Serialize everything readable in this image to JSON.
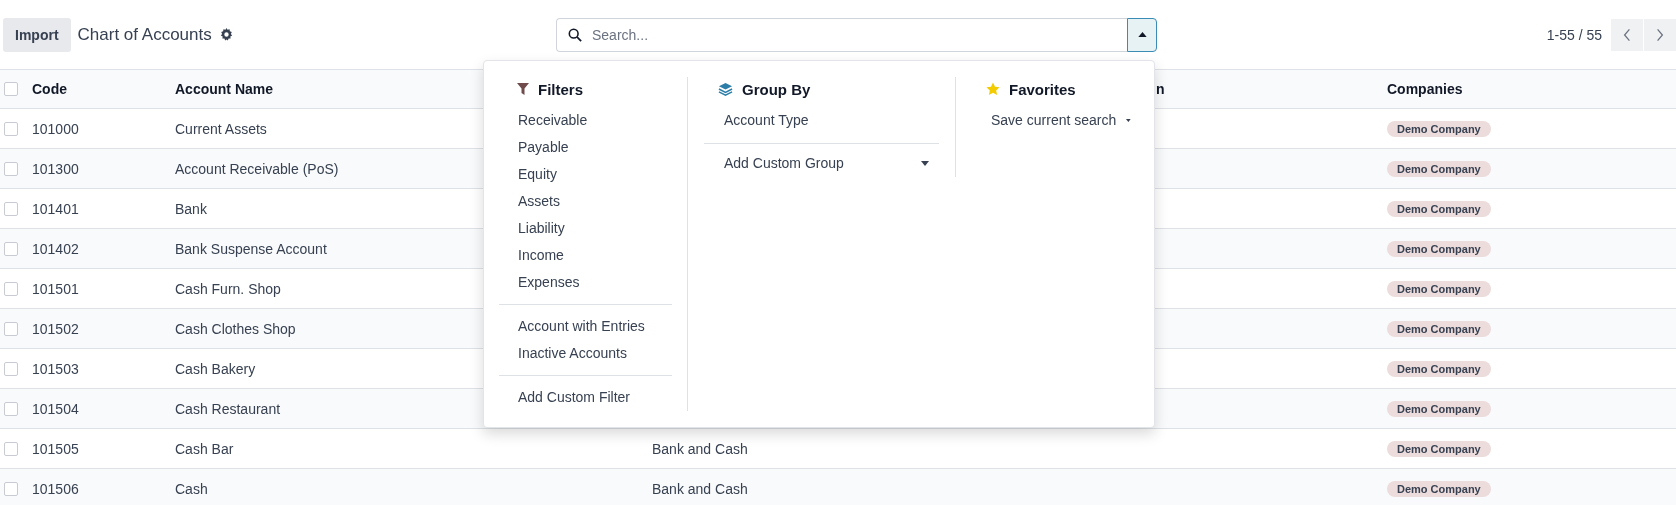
{
  "control_panel": {
    "import_button": "Import",
    "title": "Chart of Accounts",
    "search": {
      "placeholder": "Search...",
      "panel_open": true
    },
    "pager": "1-55 / 55"
  },
  "table": {
    "all_checked": false,
    "headers": {
      "code": "Code",
      "account_name": "Account Name",
      "column_4": "n",
      "companies": "Companies"
    },
    "rows": [
      {
        "selected": false,
        "code": "101000",
        "account_name": "Current Assets",
        "companies": [
          "Demo Company"
        ]
      },
      {
        "selected": false,
        "code": "101300",
        "account_name": "Account Receivable (PoS)",
        "companies": [
          "Demo Company"
        ]
      },
      {
        "selected": false,
        "code": "101401",
        "account_name": "Bank",
        "companies": [
          "Demo Company"
        ]
      },
      {
        "selected": false,
        "code": "101402",
        "account_name": "Bank Suspense Account",
        "companies": [
          "Demo Company"
        ]
      },
      {
        "selected": false,
        "code": "101501",
        "account_name": "Cash Furn. Shop",
        "companies": [
          "Demo Company"
        ]
      },
      {
        "selected": false,
        "code": "101502",
        "account_name": "Cash Clothes Shop",
        "companies": [
          "Demo Company"
        ]
      },
      {
        "selected": false,
        "code": "101503",
        "account_name": "Cash Bakery",
        "companies": [
          "Demo Company"
        ]
      },
      {
        "selected": false,
        "code": "101504",
        "account_name": "Cash Restaurant",
        "companies": [
          "Demo Company"
        ]
      },
      {
        "selected": false,
        "code": "101505",
        "account_name": "Cash Bar",
        "column_3": "Bank and Cash",
        "companies": [
          "Demo Company"
        ]
      },
      {
        "selected": false,
        "code": "101506",
        "account_name": "Cash",
        "column_3": "Bank and Cash",
        "companies": [
          "Demo Company"
        ]
      }
    ]
  },
  "search_panel": {
    "filters": {
      "title": "Filters",
      "groups": [
        {
          "items": [
            "Receivable",
            "Payable",
            "Equity",
            "Assets",
            "Liability",
            "Income",
            "Expenses"
          ]
        },
        {
          "items": [
            "Account with Entries",
            "Inactive Accounts"
          ]
        },
        {
          "items": [
            "Add Custom Filter"
          ]
        }
      ]
    },
    "group_by": {
      "title": "Group By",
      "items": [
        "Account Type"
      ],
      "custom": "Add Custom Group"
    },
    "favorites": {
      "title": "Favorites",
      "save": "Save current search"
    }
  }
}
